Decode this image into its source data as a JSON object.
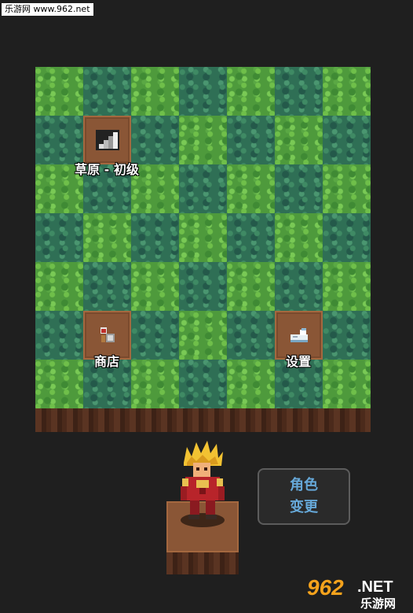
{
  "watermark_top": "乐游网 www.962.net",
  "tiles": {
    "stage": {
      "label": "草原 - 初级",
      "icon": "stairs-icon"
    },
    "shop": {
      "label": "商店",
      "icon": "potion-shop-icon"
    },
    "settings": {
      "label": "设置",
      "icon": "settings-scroll-icon"
    }
  },
  "character_button": {
    "line1": "角色",
    "line2": "变更"
  },
  "watermark_bottom": {
    "brand": "962",
    "suffix": ".NET",
    "cn": "乐游网"
  },
  "colors": {
    "background": "#1f1f1f",
    "grass_light": "#4e9a3c",
    "grass_dark": "#2f6f55",
    "dirt": "#8a5636",
    "button_text": "#66a8d8"
  }
}
